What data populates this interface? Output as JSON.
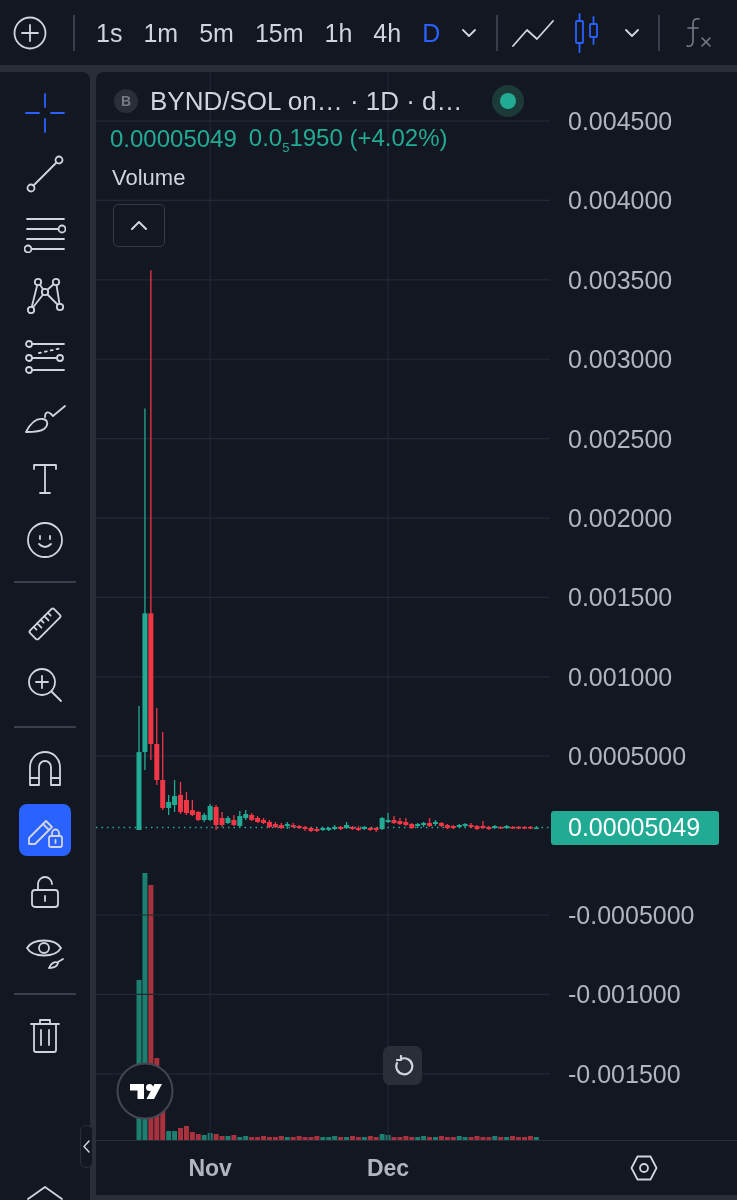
{
  "toolbar": {
    "intervals": [
      {
        "label": "1s",
        "selected": false
      },
      {
        "label": "1m",
        "selected": false
      },
      {
        "label": "5m",
        "selected": false
      },
      {
        "label": "15m",
        "selected": false
      },
      {
        "label": "1h",
        "selected": false
      },
      {
        "label": "4h",
        "selected": false
      },
      {
        "label": "D",
        "selected": true
      }
    ],
    "chart_types": [
      {
        "kind": "line",
        "selected": false
      },
      {
        "kind": "candles",
        "selected": true
      }
    ]
  },
  "sidebar": {
    "groups": [
      {
        "tools": [
          {
            "kind": "crosshair",
            "selected": true
          },
          {
            "kind": "trend-line",
            "selected": false
          },
          {
            "kind": "fib-lines",
            "selected": false
          },
          {
            "kind": "pattern",
            "selected": false
          },
          {
            "kind": "projection",
            "selected": false
          },
          {
            "kind": "brush",
            "selected": false
          },
          {
            "kind": "text",
            "selected": false
          },
          {
            "kind": "emoji",
            "selected": false
          }
        ]
      },
      {
        "tools": [
          {
            "kind": "ruler",
            "selected": false
          },
          {
            "kind": "zoom",
            "selected": false
          }
        ]
      },
      {
        "tools": [
          {
            "kind": "magnet",
            "on": false
          },
          {
            "kind": "lock-drawing",
            "on": true
          },
          {
            "kind": "lock-all",
            "on": false
          },
          {
            "kind": "hide",
            "on": false
          }
        ]
      },
      {
        "tools": [
          {
            "kind": "trash"
          }
        ]
      }
    ]
  },
  "chart": {
    "legend": {
      "symbol_badge": "B",
      "title": "BYND/SOL on… · 1D · d…",
      "market_open": true,
      "price": "0.00005049",
      "change": "0.0$_{5}$1950 (+4.02%)",
      "indicator": "Volume"
    },
    "current_price": "0.00005049",
    "chart_data": {
      "type": "candlestick",
      "grid": true,
      "categories": [
        null,
        null,
        null,
        null,
        null,
        null,
        null,
        null,
        null,
        null,
        null,
        null,
        "Nov",
        null,
        null,
        null,
        null,
        null,
        null,
        null,
        null,
        null,
        null,
        null,
        null,
        null,
        null,
        null,
        null,
        null,
        null,
        null,
        null,
        null,
        null,
        null,
        null,
        null,
        null,
        null,
        null,
        null,
        "Dec",
        null,
        null,
        null,
        null,
        null,
        null,
        null,
        null,
        null,
        null,
        null,
        null,
        null,
        null,
        null,
        null,
        null,
        null,
        null,
        null,
        null,
        null,
        null,
        null,
        null
      ],
      "ohlc": [
        [
          3.53e-05,
          0.000816,
          3.53e-05,
          0.000526
        ],
        [
          0.000526,
          0.00269,
          0.000413,
          0.0014
        ],
        [
          0.0014,
          0.00356,
          0.000476,
          0.000577
        ],
        [
          0.000577,
          0.000804,
          0.000319,
          0.00035
        ],
        [
          0.00035,
          0.000652,
          0.000161,
          0.000174
        ],
        [
          0.000174,
          0.000256,
          0.00013,
          0.000212
        ],
        [
          0.000193,
          0.00035,
          0.000149,
          0.000249
        ],
        [
          0.000256,
          0.000338,
          0.000136,
          0.000149
        ],
        [
          0.000224,
          0.000275,
          0.00013,
          0.000142
        ],
        [
          0.000161,
          0.000224,
          0.000123,
          0.00013
        ],
        [
          0.000149,
          0.000155,
          9.19e-05,
          9.82e-05
        ],
        [
          9.82e-05,
          0.000142,
          8.56e-05,
          0.00013
        ],
        [
          9.82e-05,
          0.000199,
          9.19e-05,
          0.000186
        ],
        [
          0.00018,
          0.000193,
          3.53e-05,
          6.68e-05
        ],
        [
          0.000111,
          0.000149,
          5.42e-05,
          6.68e-05
        ],
        [
          7.93e-05,
          0.000123,
          7.3e-05,
          0.000111
        ],
        [
          9.82e-05,
          0.00013,
          6.05e-05,
          6.68e-05
        ],
        [
          6.05e-05,
          0.000155,
          5.42e-05,
          0.000123
        ],
        [
          0.000111,
          0.000161,
          9.82e-05,
          0.000136
        ],
        [
          0.00013,
          0.000142,
          9.19e-05,
          9.82e-05
        ],
        [
          0.000111,
          0.000123,
          7.93e-05,
          8.56e-05
        ],
        [
          9.82e-05,
          0.000111,
          7.3e-05,
          7.93e-05
        ],
        [
          8.56e-05,
          9.82e-05,
          4.79e-05,
          5.42e-05
        ],
        [
          7.3e-05,
          8.56e-05,
          4.79e-05,
          5.42e-05
        ],
        [
          6.68e-05,
          7.93e-05,
          4.16e-05,
          4.79e-05
        ],
        [
          6.05e-05,
          8.56e-05,
          4.16e-05,
          7.3e-05
        ],
        [
          6.68e-05,
          7.93e-05,
          4.79e-05,
          5.42e-05
        ],
        [
          6.05e-05,
          6.68e-05,
          4.16e-05,
          4.79e-05
        ],
        [
          5.42e-05,
          6.05e-05,
          2.9e-05,
          4.16e-05
        ],
        [
          4.79e-05,
          5.42e-05,
          2.27e-05,
          2.9e-05
        ],
        [
          4.16e-05,
          4.79e-05,
          2.27e-05,
          2.9e-05
        ],
        [
          3.53e-05,
          5.42e-05,
          2.9e-05,
          4.79e-05
        ],
        [
          3.53e-05,
          5.42e-05,
          2.9e-05,
          4.79e-05
        ],
        [
          4.16e-05,
          6.68e-05,
          3.53e-05,
          5.42e-05
        ],
        [
          5.42e-05,
          6.05e-05,
          3.53e-05,
          4.16e-05
        ],
        [
          4.79e-05,
          8.56e-05,
          4.16e-05,
          6.68e-05
        ],
        [
          5.42e-05,
          6.05e-05,
          3.53e-05,
          4.16e-05
        ],
        [
          4.79e-05,
          6.05e-05,
          2.9e-05,
          3.53e-05
        ],
        [
          4.16e-05,
          6.05e-05,
          3.53e-05,
          5.42e-05
        ],
        [
          4.79e-05,
          5.42e-05,
          2.9e-05,
          3.53e-05
        ],
        [
          4.79e-05,
          5.42e-05,
          2.27e-05,
          3.53e-05
        ],
        [
          4.16e-05,
          0.000117,
          3.53e-05,
          0.000111
        ],
        [
          8.56e-05,
          0.000142,
          7.93e-05,
          9.82e-05
        ],
        [
          9.82e-05,
          0.000123,
          7.3e-05,
          7.93e-05
        ],
        [
          9.19e-05,
          0.000111,
          6.68e-05,
          7.3e-05
        ],
        [
          8.56e-05,
          0.000111,
          6.05e-05,
          6.68e-05
        ],
        [
          7.3e-05,
          7.93e-05,
          4.16e-05,
          4.79e-05
        ],
        [
          6.05e-05,
          7.93e-05,
          4.79e-05,
          7.3e-05
        ],
        [
          6.68e-05,
          8.56e-05,
          5.42e-05,
          7.93e-05
        ],
        [
          7.93e-05,
          0.000111,
          5.42e-05,
          6.05e-05
        ],
        [
          7.3e-05,
          9.82e-05,
          6.05e-05,
          8.56e-05
        ],
        [
          7.93e-05,
          8.56e-05,
          5.42e-05,
          6.05e-05
        ],
        [
          6.68e-05,
          7.3e-05,
          4.16e-05,
          4.79e-05
        ],
        [
          6.05e-05,
          6.68e-05,
          4.16e-05,
          4.79e-05
        ],
        [
          5.42e-05,
          7.3e-05,
          4.79e-05,
          6.68e-05
        ],
        [
          6.05e-05,
          7.93e-05,
          4.79e-05,
          7.3e-05
        ],
        [
          6.68e-05,
          7.93e-05,
          4.79e-05,
          5.42e-05
        ],
        [
          6.05e-05,
          6.68e-05,
          3.53e-05,
          4.16e-05
        ],
        [
          6.05e-05,
          9.19e-05,
          4.16e-05,
          4.79e-05
        ],
        [
          5.42e-05,
          6.05e-05,
          3.53e-05,
          4.16e-05
        ],
        [
          4.79e-05,
          6.68e-05,
          4.16e-05,
          6.05e-05
        ],
        [
          5.42e-05,
          6.05e-05,
          4.16e-05,
          4.79e-05
        ],
        [
          4.79e-05,
          6.68e-05,
          4.16e-05,
          6.05e-05
        ],
        [
          5.42e-05,
          6.05e-05,
          4.16e-05,
          4.79e-05
        ],
        [
          5.42e-05,
          6.05e-05,
          4.16e-05,
          4.79e-05
        ],
        [
          5.42e-05,
          6.05e-05,
          4.16e-05,
          4.79e-05
        ],
        [
          5.42e-05,
          6.05e-05,
          4.16e-05,
          4.85e-05
        ],
        [
          4.85e-05,
          6.05e-05,
          4.16e-05,
          5.049e-05
        ]
      ],
      "ylim": [
        -0.001917,
        0.004809
      ],
      "yticks": [
        {
          "value": 0.0045,
          "label": "0.004500"
        },
        {
          "value": 0.004,
          "label": "0.004000"
        },
        {
          "value": 0.0035,
          "label": "0.003500"
        },
        {
          "value": 0.003,
          "label": "0.003000"
        },
        {
          "value": 0.0025,
          "label": "0.002500"
        },
        {
          "value": 0.002,
          "label": "0.002000"
        },
        {
          "value": 0.0015,
          "label": "0.001500"
        },
        {
          "value": 0.001,
          "label": "0.001000"
        },
        {
          "value": 0.0005,
          "label": "0.0005000"
        },
        {
          "value": -0.0005,
          "label": "-0.0005000"
        },
        {
          "value": -0.001,
          "label": "-0.001000"
        },
        {
          "value": -0.0015,
          "label": "-0.001500"
        }
      ]
    }
  }
}
